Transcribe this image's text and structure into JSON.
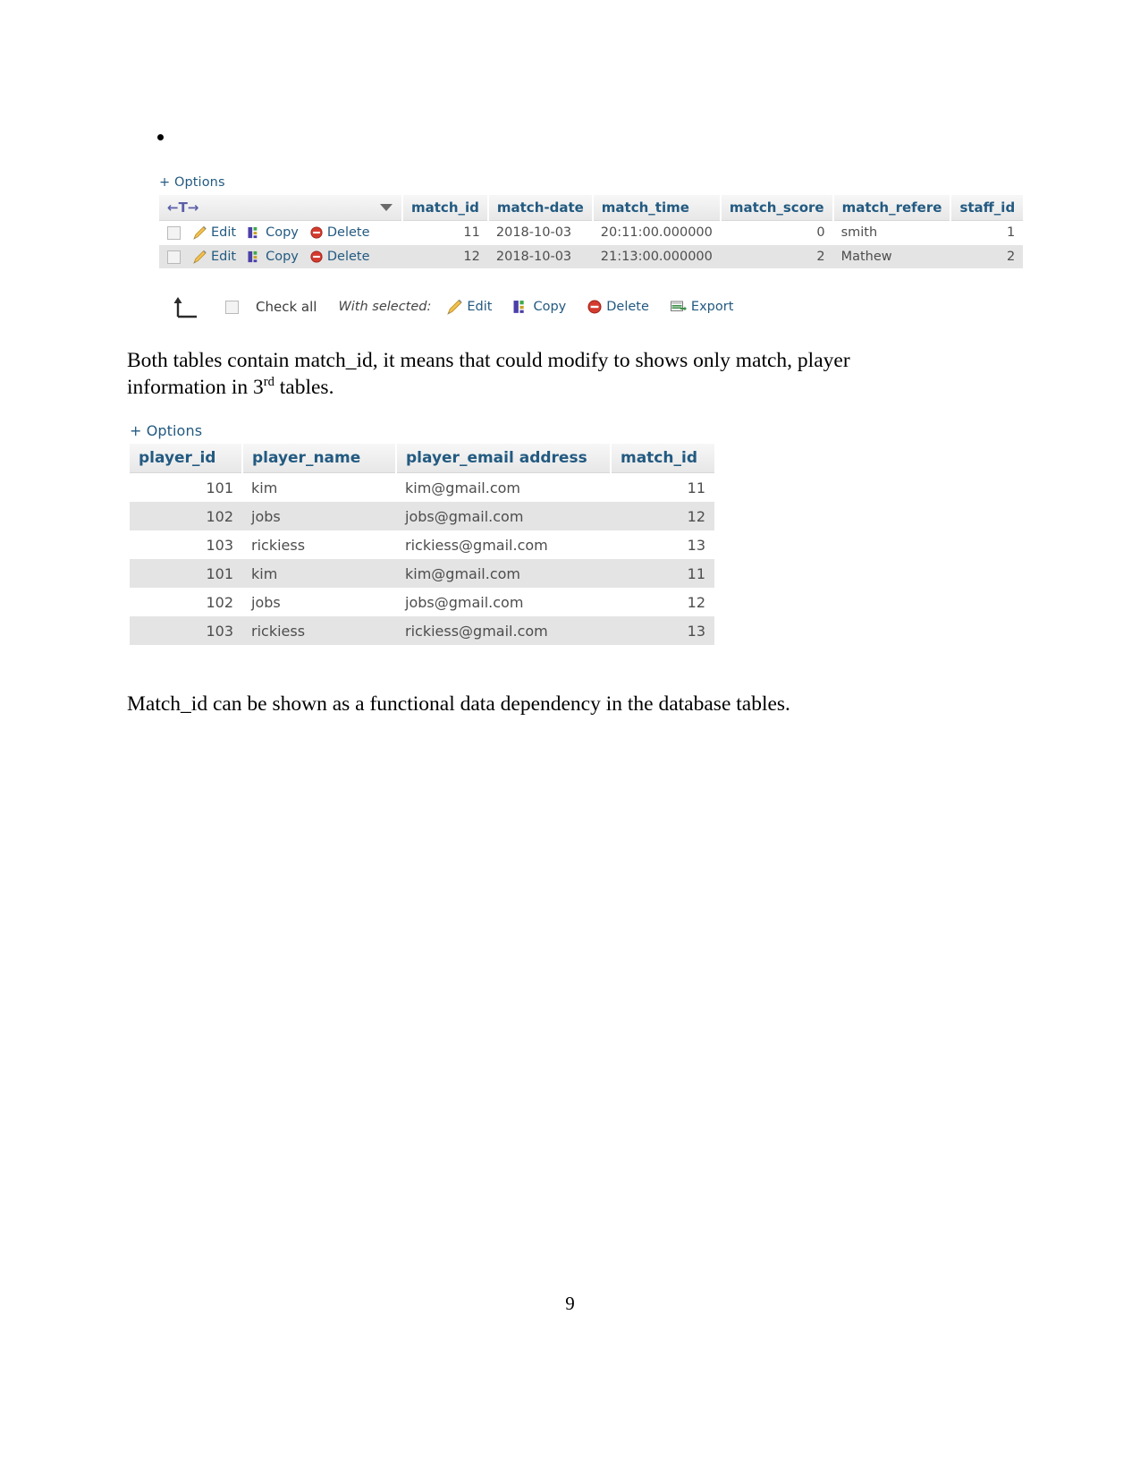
{
  "document": {
    "page_number": "9",
    "bullet": "",
    "paragraph_1_part_a": "Both tables contain match_id, it means that could modify to shows only match, player information in 3",
    "paragraph_1_sup": "rd",
    "paragraph_1_part_b": " tables.",
    "paragraph_2": "Match_id can be shown as a functional data dependency in the database tables."
  },
  "match_table": {
    "options_label": "+ Options",
    "sorter_arrows": "←T→",
    "columns": [
      "match_id",
      "match-date",
      "match_time",
      "match_score",
      "match_refere",
      "staff_id"
    ],
    "row_actions": {
      "edit": "Edit",
      "copy": "Copy",
      "delete": "Delete"
    },
    "rows": [
      {
        "match_id": "11",
        "match_date": "2018-10-03",
        "match_time": "20:11:00.000000",
        "match_score": "0",
        "match_refere": "smith",
        "staff_id": "1"
      },
      {
        "match_id": "12",
        "match_date": "2018-10-03",
        "match_time": "21:13:00.000000",
        "match_score": "2",
        "match_refere": "Mathew",
        "staff_id": "2"
      }
    ],
    "footer": {
      "check_all": "Check all",
      "with_selected": "With selected:",
      "edit": "Edit",
      "copy": "Copy",
      "delete": "Delete",
      "export": "Export"
    }
  },
  "player_table": {
    "options_label": "+ Options",
    "columns": [
      "player_id",
      "player_name",
      "player_email address",
      "match_id"
    ],
    "rows": [
      {
        "player_id": "101",
        "player_name": "kim",
        "email": "kim@gmail.com",
        "match_id": "11"
      },
      {
        "player_id": "102",
        "player_name": "jobs",
        "email": "jobs@gmail.com",
        "match_id": "12"
      },
      {
        "player_id": "103",
        "player_name": "rickiess",
        "email": "rickiess@gmail.com",
        "match_id": "13"
      },
      {
        "player_id": "101",
        "player_name": "kim",
        "email": "kim@gmail.com",
        "match_id": "11"
      },
      {
        "player_id": "102",
        "player_name": "jobs",
        "email": "jobs@gmail.com",
        "match_id": "12"
      },
      {
        "player_id": "103",
        "player_name": "rickiess",
        "email": "rickiess@gmail.com",
        "match_id": "13"
      }
    ]
  },
  "colors": {
    "header_text": "#235a81",
    "link": "#235a81",
    "row_even_bg": "#e4e4e4",
    "row_odd_bg": "#ffffff"
  }
}
